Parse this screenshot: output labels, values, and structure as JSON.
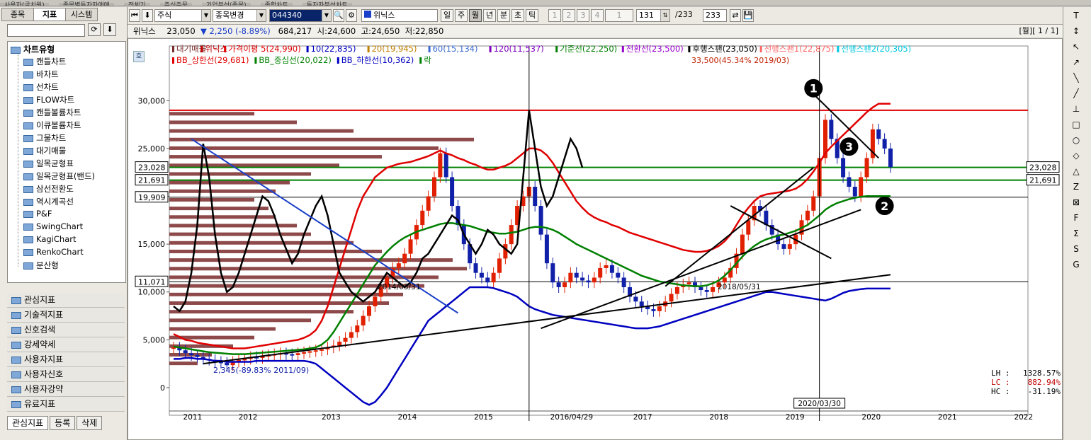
{
  "window_tabs": [
    "사용자(골치원)",
    "종목별투자자매매",
    "전체기",
    "주식주문",
    "기업분석(종목)",
    "종합차트",
    "투자자분석차트"
  ],
  "toolbar": {
    "market": "주식",
    "change_stock": "종목변경",
    "code": "044340",
    "name": "위닉스",
    "periods": [
      "일",
      "주",
      "월",
      "년",
      "분",
      "초",
      "틱"
    ],
    "active_period": "월",
    "num_buttons": [
      "1",
      "2",
      "3",
      "4",
      "1"
    ],
    "count": "131",
    "total": "/233",
    "view_count": "233"
  },
  "left_panel": {
    "tabs": [
      "종목",
      "지표",
      "시스템"
    ],
    "active_tab": "지표",
    "tree_root": "차트유형",
    "chart_types": [
      "캔들차트",
      "바차트",
      "선차트",
      "FLOW차트",
      "캔들볼륨차트",
      "이큐볼륨차트",
      "그물차트",
      "대기매물",
      "일목균형표",
      "일목균형표(밴드)",
      "삼선전환도",
      "역시계곡선",
      "P&F",
      "SwingChart",
      "KagiChart",
      "RenkoChart",
      "분산형"
    ],
    "categories": [
      "관심지표",
      "기술적지표",
      "신호검색",
      "강세약세",
      "사용자지표",
      "사용자신호",
      "사용자강약",
      "유료지표"
    ],
    "bottom_tabs": [
      "관심지표",
      "등록",
      "삭제"
    ]
  },
  "info_bar": {
    "name": "위닉스",
    "price": "23,050",
    "change": "▼ 2,250 (-8.89%)",
    "volume": "684,217",
    "open": "시:24,600",
    "high": "고:24,650",
    "low": "저:22,850",
    "period_label": "[월][ 1 / 1]"
  },
  "chart_data": {
    "type": "line",
    "mode_label": "호",
    "legend_line1": [
      {
        "text": "대기매물",
        "color": "#7a2a2a"
      },
      {
        "text": "위닉스",
        "color": "#c00000"
      },
      {
        "text": "가격이평 5(24,990)",
        "color": "#e00000"
      },
      {
        "text": "10(22,835)",
        "color": "#0000c0"
      },
      {
        "text": "20(19,945)",
        "color": "#c08000"
      },
      {
        "text": "60(15,134)",
        "color": "#3a6ad0"
      },
      {
        "text": "120(11,537)",
        "color": "#8000c0"
      },
      {
        "text": "기준선(22,250)",
        "color": "#008000"
      },
      {
        "text": "전환선(23,500)",
        "color": "#9900cc"
      },
      {
        "text": "후행스팬(23,050)",
        "color": "#000000"
      },
      {
        "text": "선행스팬1(22,875)",
        "color": "#ff6666"
      },
      {
        "text": "선행스팬2(20,305)",
        "color": "#00c8e0"
      }
    ],
    "legend_line2": [
      {
        "text": "BB_상한선(29,681)",
        "color": "#e00000"
      },
      {
        "text": "BB_중심선(20,022)",
        "color": "#008000"
      },
      {
        "text": "BB_하한선(10,362)",
        "color": "#0000c0"
      },
      {
        "text": "락",
        "color": "#008000"
      }
    ],
    "y_ticks": [
      0,
      5000,
      10000,
      15000,
      20000,
      25000,
      30000
    ],
    "y_tick_labels": [
      "0",
      "5,000",
      "10,000",
      "15,000",
      "20,000",
      "25,000",
      "30,000"
    ],
    "ylim": [
      -2000,
      33500
    ],
    "x_year_labels": [
      "2011",
      "2012",
      "2013",
      "2014",
      "2015",
      "2016/04/29",
      "2017",
      "2018",
      "2019",
      "2020",
      "2021",
      "2022"
    ],
    "hlines": [
      {
        "value": 29000,
        "color": "#e00000",
        "label": ""
      },
      {
        "value": 23028,
        "color": "#008000",
        "label": "23,028"
      },
      {
        "value": 21691,
        "color": "#008000",
        "label": "21,691"
      },
      {
        "value": 19909,
        "color": "#000000",
        "label": "19,909"
      },
      {
        "value": 11071,
        "color": "#000000",
        "label": "11,071"
      }
    ],
    "annotations": {
      "max": "33,500(45.34% 2019/03)",
      "min": "2,345(-89.83% 2011/09)",
      "date1": "2014/03/31",
      "date2": "2018/05/31",
      "cursor_date": "2020/03/30",
      "markers": [
        "1",
        "2",
        "3"
      ]
    },
    "stats": {
      "LH": "1328.57%",
      "LC": "882.94%",
      "HC": "-31.19%"
    },
    "candles_monthly_close": [
      4200,
      3900,
      3600,
      3400,
      3200,
      3000,
      2900,
      2700,
      2600,
      2345,
      2700,
      2900,
      3000,
      3200,
      3100,
      3300,
      3400,
      3500,
      3600,
      3500,
      3400,
      3600,
      3700,
      3800,
      3900,
      4000,
      4200,
      4400,
      4800,
      5200,
      5800,
      6500,
      7500,
      8500,
      9500,
      10500,
      11500,
      12500,
      13000,
      14000,
      15500,
      17000,
      18500,
      20000,
      22000,
      24500,
      22000,
      19000,
      17000,
      15000,
      13000,
      12000,
      11500,
      11000,
      12000,
      13500,
      15000,
      17000,
      19000,
      20000,
      21000,
      19000,
      16000,
      13000,
      11000,
      10500,
      11000,
      12000,
      11500,
      11200,
      11000,
      11500,
      12500,
      12800,
      12000,
      11500,
      10500,
      9500,
      9000,
      8500,
      8200,
      8000,
      8500,
      9000,
      9800,
      10500,
      10800,
      11000,
      10500,
      10200,
      10000,
      10500,
      11000,
      11500,
      12500,
      14000,
      16000,
      17500,
      19000,
      18500,
      17000,
      16000,
      15000,
      14500,
      15000,
      16000,
      17500,
      18500,
      20000,
      24000,
      28000,
      26000,
      24000,
      22000,
      21000,
      20000,
      22000,
      24000,
      27000,
      26000,
      25000,
      23050
    ],
    "bb_upper": [
      5600,
      5300,
      5000,
      4900,
      4700,
      4600,
      4500,
      4400,
      4300,
      4200,
      4100,
      4100,
      4100,
      4200,
      4300,
      4400,
      4500,
      4600,
      4700,
      4800,
      4900,
      5000,
      5200,
      5500,
      6000,
      7000,
      8500,
      10500,
      12500,
      14500,
      16500,
      18500,
      20000,
      21000,
      22000,
      22500,
      23000,
      23200,
      23400,
      23500,
      23600,
      23800,
      24000,
      24200,
      24500,
      24800,
      24500,
      24300,
      24000,
      23800,
      23500,
      23300,
      23000,
      22800,
      22800,
      23000,
      23200,
      23500,
      24000,
      24500,
      25000,
      25000,
      24800,
      24300,
      23500,
      22500,
      21500,
      20500,
      19500,
      18800,
      18200,
      17800,
      17500,
      17300,
      17000,
      16800,
      16500,
      16200,
      16000,
      15800,
      15600,
      15400,
      15200,
      15000,
      14800,
      14600,
      14400,
      14300,
      14200,
      14200,
      14300,
      14500,
      14800,
      15300,
      16000,
      17000,
      18000,
      18800,
      19500,
      20000,
      20200,
      20300,
      20400,
      20500,
      20600,
      20800,
      21200,
      21800,
      22600,
      23500,
      24500,
      25200,
      25800,
      26400,
      27000,
      27600,
      28200,
      28800,
      29300,
      29681,
      29681,
      29681
    ],
    "bb_mid": [
      4300,
      4200,
      4100,
      4000,
      3900,
      3800,
      3700,
      3650,
      3600,
      3550,
      3500,
      3500,
      3500,
      3550,
      3600,
      3650,
      3700,
      3750,
      3800,
      3850,
      3900,
      3950,
      4000,
      4100,
      4200,
      4500,
      5000,
      5800,
      6800,
      7800,
      8800,
      9800,
      10800,
      11800,
      12800,
      13500,
      14200,
      14800,
      15300,
      15700,
      16000,
      16300,
      16500,
      16700,
      16900,
      17100,
      17200,
      17200,
      17100,
      17000,
      16900,
      16700,
      16500,
      16300,
      16200,
      16100,
      16100,
      16200,
      16300,
      16500,
      16700,
      16800,
      16800,
      16700,
      16500,
      16200,
      15800,
      15400,
      15000,
      14700,
      14400,
      14100,
      13800,
      13500,
      13200,
      12900,
      12600,
      12300,
      12000,
      11700,
      11500,
      11300,
      11100,
      11000,
      10900,
      10800,
      10700,
      10650,
      10600,
      10600,
      10700,
      10900,
      11200,
      11700,
      12300,
      13000,
      13700,
      14300,
      14800,
      15200,
      15500,
      15700,
      15900,
      16000,
      16200,
      16400,
      16700,
      17000,
      17500,
      18000,
      18600,
      19000,
      19300,
      19500,
      19700,
      19850,
      19950,
      20022,
      20022,
      20022,
      20022,
      20022
    ],
    "bb_lower": [
      3000,
      3000,
      3100,
      3100,
      3000,
      3000,
      2900,
      2800,
      2800,
      2700,
      2700,
      2700,
      2700,
      2700,
      2800,
      2800,
      2800,
      2800,
      2800,
      2800,
      2800,
      2800,
      2800,
      2700,
      2500,
      2000,
      1500,
      1000,
      500,
      0,
      -500,
      -1000,
      -1500,
      -1800,
      -1500,
      -800,
      0,
      1000,
      2000,
      3000,
      4000,
      5000,
      6000,
      7000,
      7500,
      8000,
      8500,
      9000,
      9500,
      10000,
      10500,
      10500,
      10500,
      10500,
      10400,
      10200,
      10000,
      9800,
      9500,
      9000,
      8500,
      8200,
      8000,
      7800,
      7600,
      7500,
      7400,
      7300,
      7200,
      7100,
      7000,
      6900,
      6800,
      6700,
      6600,
      6500,
      6400,
      6300,
      6200,
      6200,
      6200,
      6300,
      6400,
      6600,
      6800,
      7000,
      7200,
      7400,
      7600,
      7800,
      8000,
      8200,
      8400,
      8600,
      8800,
      9000,
      9200,
      9400,
      9600,
      9800,
      10000,
      10000,
      9900,
      9800,
      9700,
      9600,
      9500,
      9400,
      9300,
      9200,
      9100,
      9300,
      9600,
      9900,
      10100,
      10200,
      10300,
      10362,
      10362,
      10362,
      10362,
      10362
    ],
    "lagging_span": [
      8500,
      8000,
      9000,
      12000,
      17000,
      25500,
      22000,
      16000,
      12000,
      10000,
      10500,
      12000,
      14000,
      16000,
      18000,
      20000,
      19500,
      18000,
      16000,
      14500,
      13000,
      14000,
      16000,
      17500,
      19000,
      20000,
      18000,
      15000,
      12000,
      11000,
      10000,
      9500,
      9000,
      9500,
      10000,
      11000,
      12000,
      11500,
      11000,
      10500,
      11000,
      12000,
      13500,
      14000,
      15000,
      16000,
      17000,
      18000,
      17500,
      16000,
      15000,
      14000,
      15000,
      16500,
      16000,
      15000,
      14500,
      14000,
      15000,
      22000,
      29000,
      25000,
      21000,
      19000,
      20000,
      22000,
      24000,
      26000,
      25000,
      23000
    ],
    "trendlines": [
      {
        "from": [
          3,
          26000
        ],
        "to": [
          48,
          7800
        ],
        "color": "#1a3fc8"
      },
      {
        "from": [
          5,
          2500
        ],
        "to": [
          121,
          11800
        ],
        "color": "#000000"
      },
      {
        "from": [
          62,
          6200
        ],
        "to": [
          116,
          18600
        ],
        "color": "#000000"
      },
      {
        "from": [
          83,
          10600
        ],
        "to": [
          108,
          23000
        ],
        "color": "#000000"
      },
      {
        "from": [
          94,
          19000
        ],
        "to": [
          111,
          13500
        ],
        "color": "#000000"
      },
      {
        "from": [
          107,
          31300
        ],
        "to": [
          119,
          24000
        ],
        "color": "#000000"
      }
    ]
  },
  "right_tools": [
    "T",
    "↕",
    "↖",
    "↗",
    "╲",
    "╱",
    "⊥",
    "□",
    "○",
    "◇",
    "△",
    "Z",
    "⊠",
    "F",
    "Σ",
    "S",
    "G"
  ]
}
